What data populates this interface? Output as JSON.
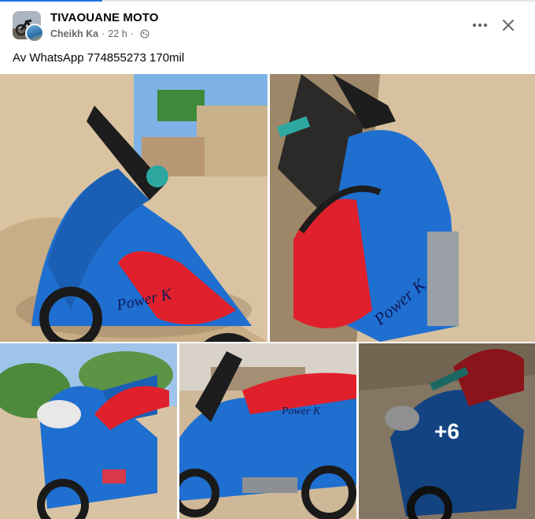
{
  "post": {
    "group_name": "TIVAOUANE MOTO",
    "author": "Cheikh Ka",
    "time": "22 h",
    "separator": "·",
    "text": "Av WhatsApp 774855273 170mil",
    "audience_icon": "globe-icon"
  },
  "header_actions": {
    "more_icon": "ellipsis-icon",
    "close_icon": "close-icon"
  },
  "photos": {
    "extra_count": "+6",
    "seat_text": "Power K"
  },
  "colors": {
    "text_primary": "#050505",
    "text_secondary": "#65676b",
    "accent": "#1b74e4",
    "moto_blue": "#1f6fd0",
    "seat_red": "#e0202a"
  }
}
